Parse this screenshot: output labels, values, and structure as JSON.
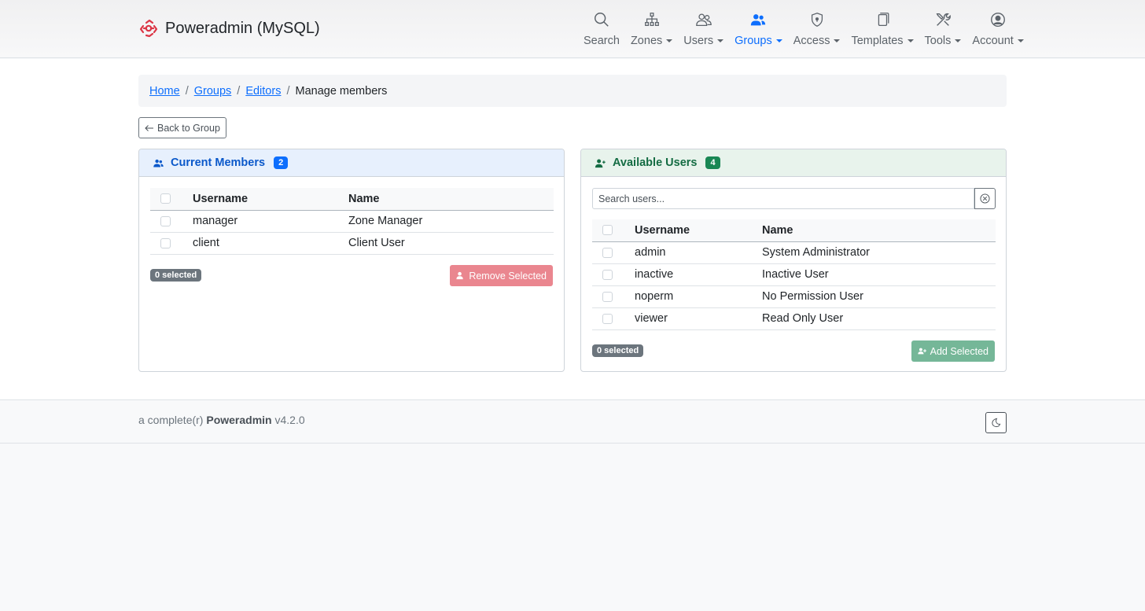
{
  "brand": {
    "title": "Poweradmin (MySQL)",
    "logo_color": "#dc3545"
  },
  "nav": [
    {
      "label": "Search",
      "icon": "search-icon",
      "dropdown": false,
      "active": false
    },
    {
      "label": "Zones",
      "icon": "sitemap-icon",
      "dropdown": true,
      "active": false
    },
    {
      "label": "Users",
      "icon": "people-icon",
      "dropdown": true,
      "active": false
    },
    {
      "label": "Groups",
      "icon": "people-fill-icon",
      "dropdown": true,
      "active": true
    },
    {
      "label": "Access",
      "icon": "shield-icon",
      "dropdown": true,
      "active": false
    },
    {
      "label": "Templates",
      "icon": "copy-icon",
      "dropdown": true,
      "active": false
    },
    {
      "label": "Tools",
      "icon": "tools-icon",
      "dropdown": true,
      "active": false
    },
    {
      "label": "Account",
      "icon": "person-circle-icon",
      "dropdown": true,
      "active": false
    }
  ],
  "breadcrumb": {
    "home": "Home",
    "groups": "Groups",
    "group": "Editors",
    "current": "Manage members"
  },
  "back_button": "Back to Group",
  "current_members": {
    "title": "Current Members",
    "count": "2",
    "headers": {
      "username": "Username",
      "name": "Name"
    },
    "rows": [
      {
        "username": "manager",
        "name": "Zone Manager"
      },
      {
        "username": "client",
        "name": "Client User"
      }
    ],
    "selected": "0 selected",
    "action": "Remove Selected"
  },
  "available_users": {
    "title": "Available Users",
    "count": "4",
    "search_placeholder": "Search users...",
    "headers": {
      "username": "Username",
      "name": "Name"
    },
    "rows": [
      {
        "username": "admin",
        "name": "System Administrator"
      },
      {
        "username": "inactive",
        "name": "Inactive User"
      },
      {
        "username": "noperm",
        "name": "No Permission User"
      },
      {
        "username": "viewer",
        "name": "Read Only User"
      }
    ],
    "selected": "0 selected",
    "action": "Add Selected"
  },
  "footer": {
    "prefix": "a complete(r)",
    "product": "Poweradmin",
    "version": "v4.2.0"
  },
  "colors": {
    "primary": "#0d6efd",
    "success": "#198754",
    "danger_light": "#ea868f",
    "success_light": "#75b798",
    "secondary": "#6c757d"
  }
}
